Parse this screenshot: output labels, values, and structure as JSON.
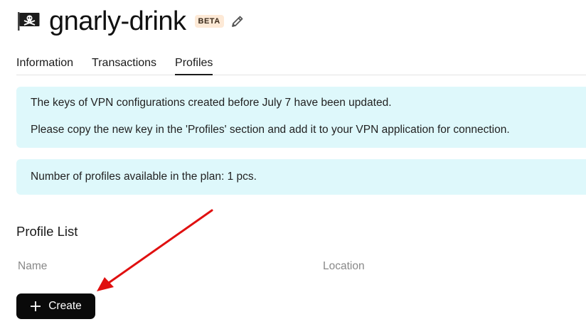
{
  "header": {
    "title": "gnarly-drink",
    "badge": "BETA",
    "flag_icon": "pirate-flag-icon",
    "edit_icon": "pencil-icon"
  },
  "tabs": [
    {
      "label": "Information",
      "active": false
    },
    {
      "label": "Transactions",
      "active": false
    },
    {
      "label": "Profiles",
      "active": true
    }
  ],
  "notices": {
    "update_line1": "The keys of VPN configurations created before July 7 have been updated.",
    "update_line2": "Please copy the new key in the 'Profiles' section and add it to your VPN application for connection.",
    "plan_info": "Number of profiles available in the plan: 1 pcs."
  },
  "profile_list": {
    "title": "Profile List",
    "columns": [
      "Name",
      "Location"
    ],
    "create_label": "Create",
    "create_icon": "plus-icon"
  },
  "colors": {
    "notice_bg": "#def8fb",
    "badge_bg": "#fde9d6",
    "button_bg": "#0a0a0a",
    "arrow": "#e01010"
  }
}
